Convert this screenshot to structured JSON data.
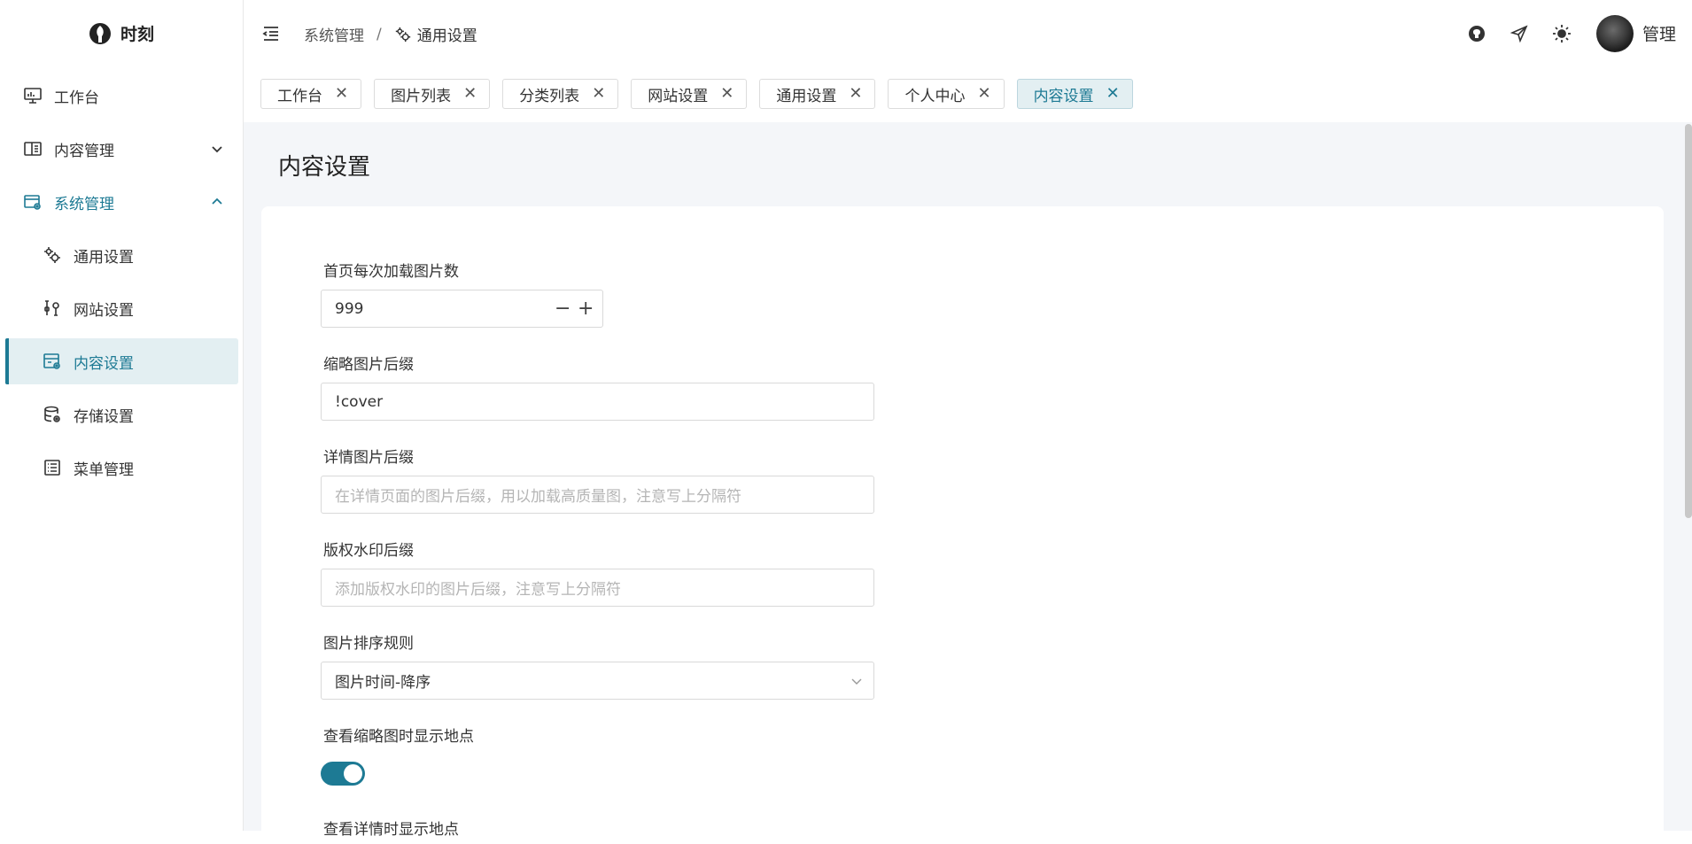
{
  "app": {
    "name": "时刻"
  },
  "sidebar": {
    "items": [
      {
        "label": "工作台",
        "icon": "monitor-icon"
      },
      {
        "label": "内容管理",
        "icon": "content-icon",
        "expanded": false
      },
      {
        "label": "系统管理",
        "icon": "system-icon",
        "expanded": true
      },
      {
        "label": "通用设置",
        "icon": "gears-icon"
      },
      {
        "label": "网站设置",
        "icon": "tools-icon"
      },
      {
        "label": "内容设置",
        "icon": "content-settings-icon",
        "selected": true
      },
      {
        "label": "存储设置",
        "icon": "database-icon"
      },
      {
        "label": "菜单管理",
        "icon": "list-icon"
      }
    ]
  },
  "header": {
    "breadcrumb": [
      "系统管理",
      "通用设置"
    ],
    "separator": "/",
    "username": "管理"
  },
  "tabs": [
    {
      "label": "工作台"
    },
    {
      "label": "图片列表"
    },
    {
      "label": "分类列表"
    },
    {
      "label": "网站设置"
    },
    {
      "label": "通用设置"
    },
    {
      "label": "个人中心"
    },
    {
      "label": "内容设置",
      "active": true
    }
  ],
  "page": {
    "title": "内容设置",
    "fields": {
      "images_per_load": {
        "label": "首页每次加载图片数",
        "value": "999"
      },
      "thumb_suffix": {
        "label": "缩略图片后缀",
        "value": "!cover"
      },
      "detail_suffix": {
        "label": "详情图片后缀",
        "placeholder": "在详情页面的图片后缀，用以加载高质量图，注意写上分隔符"
      },
      "watermark_suffix": {
        "label": "版权水印后缀",
        "placeholder": "添加版权水印的图片后缀，注意写上分隔符"
      },
      "sort_rule": {
        "label": "图片排序规则",
        "value": "图片时间-降序"
      },
      "thumb_location": {
        "label": "查看缩略图时显示地点",
        "enabled": true
      },
      "detail_location": {
        "label": "查看详情时显示地点"
      }
    }
  },
  "colors": {
    "accent": "#1d7a94",
    "content_bg": "#f4f6f9"
  }
}
